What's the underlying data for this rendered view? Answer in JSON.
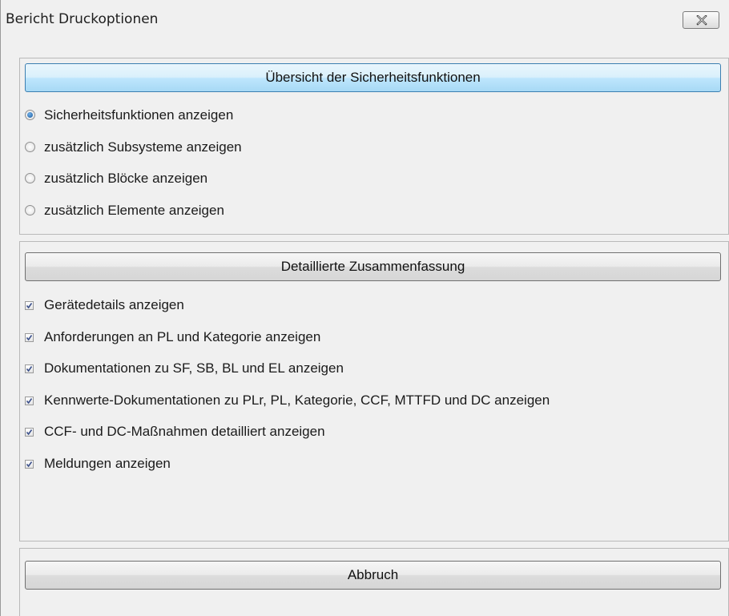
{
  "window": {
    "title": "Bericht Druckoptionen"
  },
  "overview": {
    "button_label": "Übersicht der Sicherheitsfunktionen",
    "options": [
      {
        "label": "Sicherheitsfunktionen anzeigen",
        "selected": true
      },
      {
        "label": "zusätzlich Subsysteme anzeigen",
        "selected": false
      },
      {
        "label": "zusätzlich Blöcke anzeigen",
        "selected": false
      },
      {
        "label": "zusätzlich Elemente anzeigen",
        "selected": false
      }
    ]
  },
  "summary": {
    "button_label": "Detaillierte Zusammenfassung",
    "options": [
      {
        "label": "Gerätedetails anzeigen",
        "checked": true
      },
      {
        "label": "Anforderungen an PL und Kategorie anzeigen",
        "checked": true
      },
      {
        "label": "Dokumentationen zu SF, SB, BL und EL anzeigen",
        "checked": true
      },
      {
        "label": "Kennwerte-Dokumentationen zu PLr, PL, Kategorie, CCF, MTTFD und DC  anzeigen",
        "checked": true
      },
      {
        "label": "CCF- und DC-Maßnahmen detailliert anzeigen",
        "checked": true
      },
      {
        "label": "Meldungen anzeigen",
        "checked": true
      }
    ]
  },
  "footer": {
    "cancel_label": "Abbruch"
  },
  "icons": {
    "close": "close-icon",
    "checkmark": "checkmark-icon"
  },
  "colors": {
    "window_bg": "#f0f0f0",
    "active_button": "#bee6fd",
    "radio_dot": "#1d5a9b"
  }
}
